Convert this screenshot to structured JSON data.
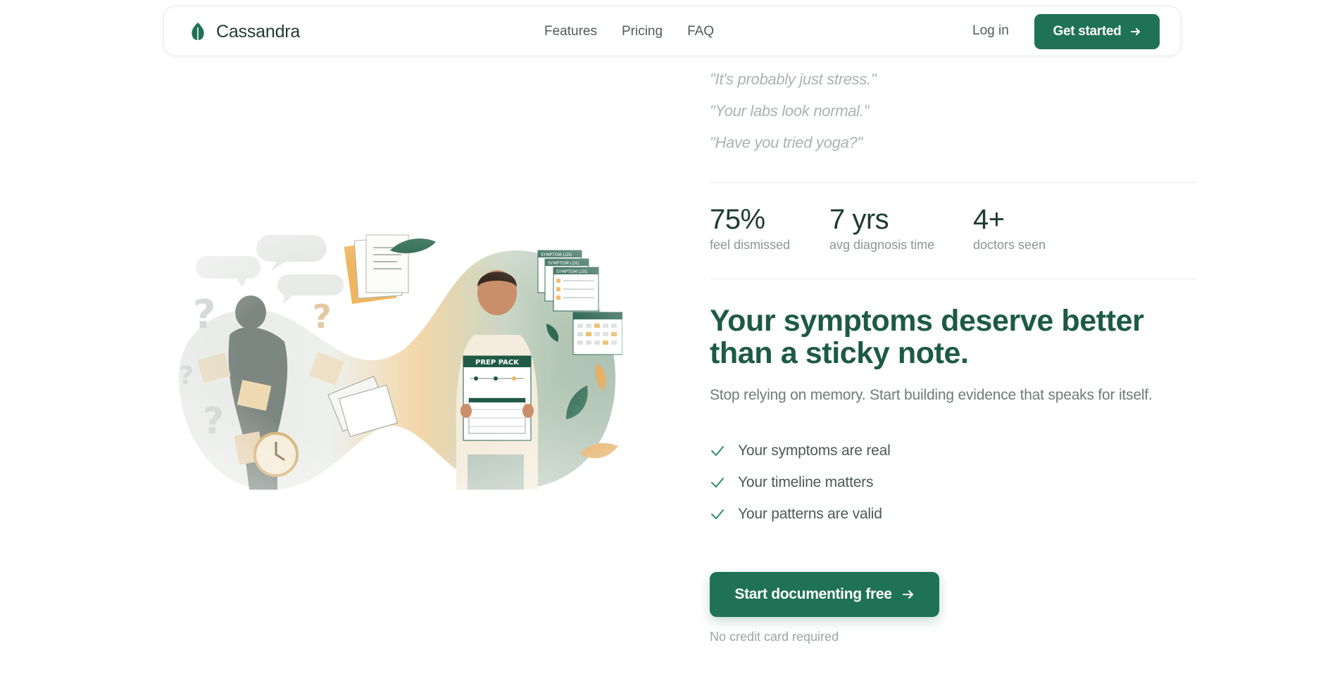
{
  "nav": {
    "brand": "Cassandra",
    "links": [
      "Features",
      "Pricing",
      "FAQ"
    ],
    "login": "Log in",
    "cta": "Get started"
  },
  "quotes": [
    "\"It's probably just stress.\"",
    "\"Your labs look normal.\"",
    "\"Have you tried yoga?\""
  ],
  "stats": [
    {
      "value": "75%",
      "label": "feel dismissed"
    },
    {
      "value": "7 yrs",
      "label": "avg diagnosis time"
    },
    {
      "value": "4+",
      "label": "doctors seen"
    }
  ],
  "hero": {
    "headline": "Your symptoms deserve better than a sticky note.",
    "subhead": "Stop relying on memory. Start building evidence that speaks for itself.",
    "checks": [
      "Your symptoms are real",
      "Your timeline matters",
      "Your patterns are valid"
    ],
    "cta": "Start documenting free",
    "fine_print": "No credit card required"
  },
  "illustration": {
    "prep_pack": "PREP PACK",
    "log_label": "SYMPTOM LOG"
  },
  "colors": {
    "primary": "#1f7255",
    "headline": "#1d5a45",
    "accent_orange": "#e0a24a",
    "muted": "#8a9893"
  }
}
